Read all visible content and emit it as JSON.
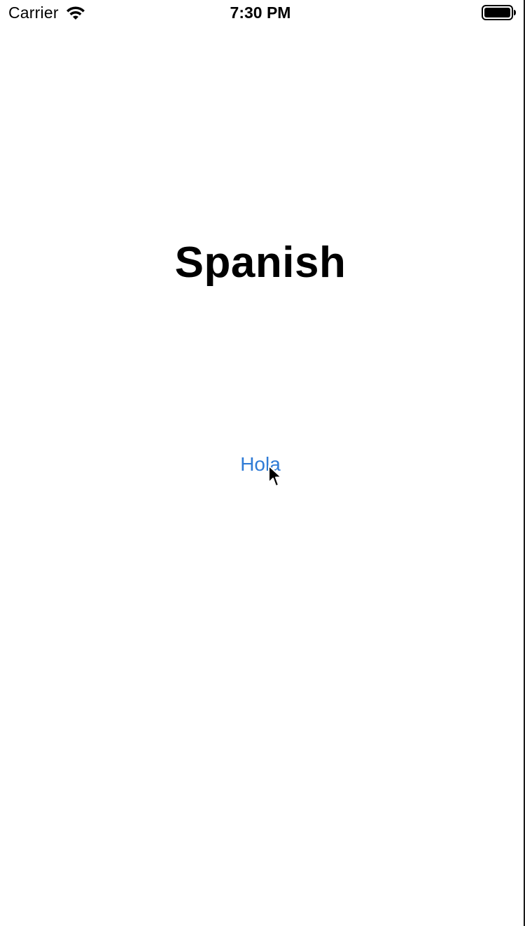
{
  "status_bar": {
    "carrier": "Carrier",
    "time": "7:30 PM",
    "wifi_icon": "wifi-icon",
    "battery_icon": "battery-icon"
  },
  "screen": {
    "title": "Spanish",
    "button_label": "Hola",
    "button_color": "#2f7bd6",
    "pointer_icon": "mouse-pointer-icon"
  }
}
